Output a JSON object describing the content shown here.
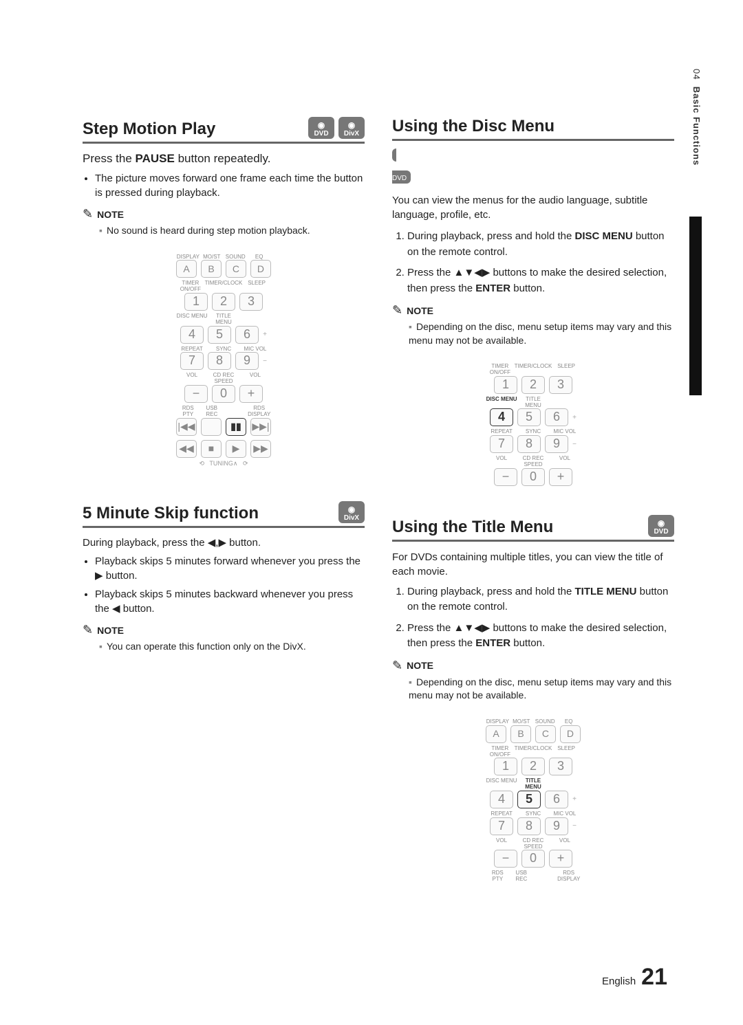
{
  "sidebar": {
    "chapter": "04",
    "title": "Basic Functions"
  },
  "badges": {
    "dvd": "DVD",
    "divx": "DivX",
    "disc_dot": "◉"
  },
  "step_motion": {
    "heading": "Step Motion Play",
    "intro_pre": "Press the ",
    "intro_bold": "PAUSE",
    "intro_post": " button repeatedly.",
    "bullet": "The picture moves forward one frame each time the button is pressed during playback.",
    "note_label": "NOTE",
    "note_body": "No sound is heard during step motion playback."
  },
  "skip": {
    "heading": "5 Minute Skip function",
    "intro": "During playback, press the ◀,▶ button.",
    "b1": "Playback skips 5 minutes forward whenever you press the ▶ button.",
    "b2": "Playback skips 5 minutes backward whenever you press the ◀ button.",
    "note_label": "NOTE",
    "note_body": "You can operate this function only on the DivX."
  },
  "disc_menu": {
    "heading": "Using the Disc Menu",
    "intro": "You can view the menus for the audio language, subtitle language, profile, etc.",
    "s1_pre": "During playback, press and hold the ",
    "s1_bold": "DISC MENU",
    "s1_post": " button on the remote control.",
    "s2_pre": "Press the ▲▼◀▶ buttons to make the desired selection, then press the ",
    "s2_bold": "ENTER",
    "s2_post": " button.",
    "note_label": "NOTE",
    "note_body": "Depending on the disc, menu setup items may vary and this menu may not be available."
  },
  "title_menu": {
    "heading": "Using the Title Menu",
    "intro": "For DVDs containing multiple titles, you can view the title of each movie.",
    "s1_pre": "During playback, press and hold the ",
    "s1_bold": "TITLE MENU",
    "s1_post": " button on the remote control.",
    "s2_pre": "Press the ▲▼◀▶ buttons to make the desired selection, then press the ",
    "s2_bold": "ENTER",
    "s2_post": " button.",
    "note_label": "NOTE",
    "note_body": "Depending on the disc, menu setup items may vary and this menu may not be available."
  },
  "remote_labels": {
    "row0": [
      "DISPLAY",
      "MO/ST",
      "SOUND",
      "EQ"
    ],
    "rowA": [
      "A",
      "B",
      "C",
      "D"
    ],
    "row1": [
      "TIMER ON/OFF",
      "TIMER/CLOCK",
      "SLEEP"
    ],
    "n1": [
      "1",
      "2",
      "3"
    ],
    "row2": [
      "DISC MENU",
      "TITLE MENU",
      ""
    ],
    "n2": [
      "4",
      "5",
      "6"
    ],
    "row3": [
      "REPEAT",
      "SYNC",
      "MIC VOL"
    ],
    "n3": [
      "7",
      "8",
      "9"
    ],
    "row4": [
      "VOL",
      "CD REC SPEED",
      "VOL"
    ],
    "n4": [
      "−",
      "0",
      "+"
    ],
    "row5": [
      "RDS PTY",
      "USB REC",
      "",
      "RDS DISPLAY"
    ],
    "transport": [
      "|◀◀",
      "",
      "▮▮",
      "▶▶|"
    ],
    "transport2": [
      "◀◀",
      "■",
      "▶",
      "▶▶"
    ],
    "tuning": "TUNING"
  },
  "footer": {
    "lang": "English",
    "page": "21"
  }
}
